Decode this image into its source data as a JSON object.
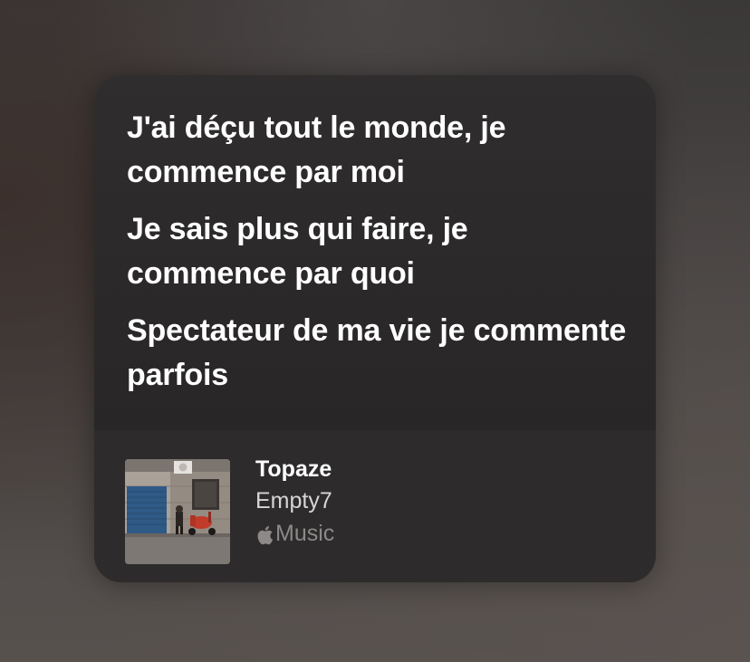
{
  "lyrics": {
    "lines": [
      "J'ai déçu tout le monde, je commence par moi",
      "Je sais plus qui faire, je commence par quoi",
      "Spectateur de ma vie je commente parfois"
    ]
  },
  "track": {
    "title": "Topaze",
    "artist": "Empty7",
    "service_label": "Music",
    "artwork_icon": "album-artwork"
  },
  "icons": {
    "service_icon": "apple-logo-icon"
  },
  "colors": {
    "card_background": "#2b2929",
    "text_primary": "#ffffff",
    "text_secondary": "#d8d6d5",
    "text_tertiary": "#8c8988"
  }
}
